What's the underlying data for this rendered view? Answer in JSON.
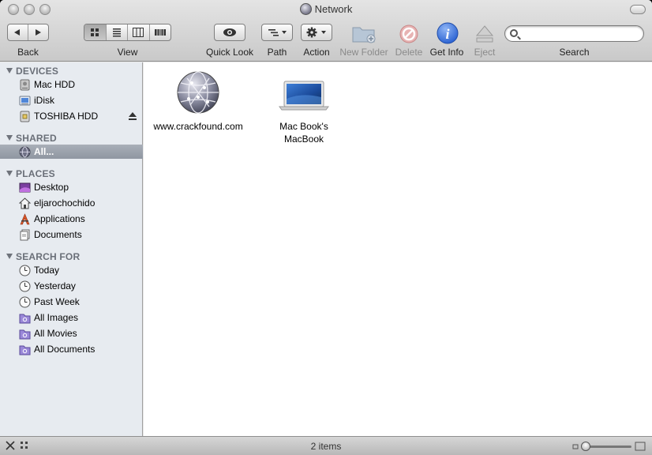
{
  "window": {
    "title": "Network"
  },
  "toolbar": {
    "back_label": "Back",
    "view_label": "View",
    "quick_look_label": "Quick Look",
    "path_label": "Path",
    "action_label": "Action",
    "new_folder_label": "New Folder",
    "delete_label": "Delete",
    "get_info_label": "Get Info",
    "eject_label": "Eject",
    "search_label": "Search"
  },
  "search": {
    "value": "",
    "placeholder": ""
  },
  "sidebar": {
    "devices": {
      "heading": "DEVICES",
      "items": [
        {
          "label": "Mac HDD",
          "icon": "hard-drive-icon"
        },
        {
          "label": "iDisk",
          "icon": "idisk-icon"
        },
        {
          "label": "TOSHIBA HDD",
          "icon": "external-drive-icon"
        }
      ]
    },
    "shared": {
      "heading": "SHARED",
      "items": [
        {
          "label": "All...",
          "icon": "network-globe-icon",
          "selected": true
        }
      ]
    },
    "places": {
      "heading": "PLACES",
      "items": [
        {
          "label": "Desktop",
          "icon": "desktop-icon"
        },
        {
          "label": "eljarochochido",
          "icon": "home-icon"
        },
        {
          "label": "Applications",
          "icon": "applications-icon"
        },
        {
          "label": "Documents",
          "icon": "documents-icon"
        }
      ]
    },
    "search_for": {
      "heading": "SEARCH FOR",
      "items": [
        {
          "label": "Today",
          "icon": "clock-icon"
        },
        {
          "label": "Yesterday",
          "icon": "clock-icon"
        },
        {
          "label": "Past Week",
          "icon": "clock-icon"
        },
        {
          "label": "All Images",
          "icon": "smart-folder-icon"
        },
        {
          "label": "All Movies",
          "icon": "smart-folder-icon"
        },
        {
          "label": "All Documents",
          "icon": "smart-folder-icon"
        }
      ]
    }
  },
  "content": {
    "items": [
      {
        "name": "www.crackfound.com",
        "icon": "network-globe-icon"
      },
      {
        "name": "Mac Book's MacBook",
        "icon": "macbook-icon"
      }
    ]
  },
  "status": {
    "text": "2 items"
  },
  "colors": {
    "accent": "#2c63d2",
    "sidebar_bg": "#e7ebf0",
    "selection": "#9aa0aa"
  }
}
